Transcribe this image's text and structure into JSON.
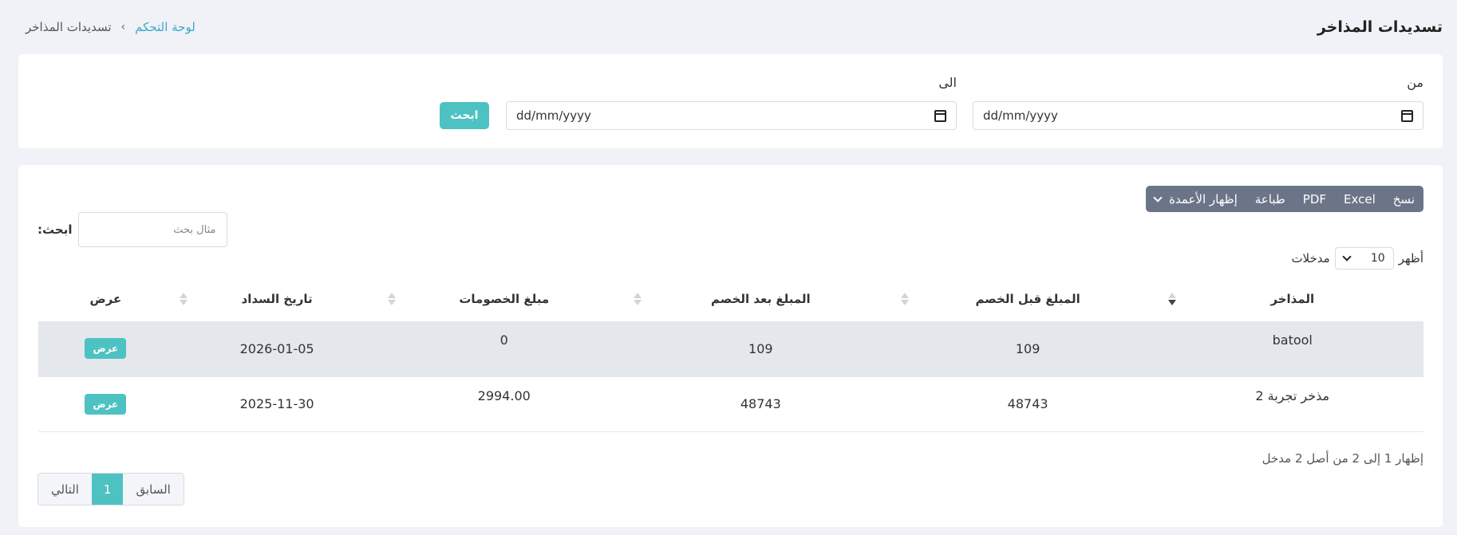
{
  "header": {
    "title": "تسديدات المذاخر",
    "breadcrumb": {
      "home": "لوحة التحكم",
      "separator": "›",
      "current": "تسديدات المذاخر"
    }
  },
  "filter": {
    "from_label": "من",
    "to_label": "الى",
    "from_value": "dd/mm/yyyy",
    "to_value": "dd/mm/yyyy",
    "search_button": "ابحث"
  },
  "toolbar": {
    "copy": "نسخ",
    "excel": "Excel",
    "pdf": "PDF",
    "print": "طباعة",
    "columns": "إظهار الأعمدة"
  },
  "table_search": {
    "label": "ابحث:",
    "placeholder": "مثال بحث"
  },
  "length": {
    "show": "أظهر",
    "value": "10",
    "entries": "مدخلات"
  },
  "table": {
    "columns": [
      "المذاخر",
      "المبلغ قبل الخصم",
      "المبلغ بعد الخصم",
      "مبلغ الخصومات",
      "تاريخ السداد",
      "عرض"
    ],
    "rows": [
      {
        "name": "batool",
        "before": "109",
        "after": "109",
        "discount": "0",
        "date": "2026-01-05",
        "action": "عرض"
      },
      {
        "name": "مذخر تجربة 2",
        "before": "48743",
        "after": "48743",
        "discount": "2994.00",
        "date": "2025-11-30",
        "action": "عرض"
      }
    ]
  },
  "info": "إظهار 1 إلى 2 من أصل 2 مدخل",
  "pagination": {
    "prev": "السابق",
    "page": "1",
    "next": "التالي"
  },
  "colors": {
    "accent": "#4ec2c2",
    "toolbar": "#6c7588",
    "link": "#3aa7c9",
    "stripe": "#e4e7ec"
  }
}
